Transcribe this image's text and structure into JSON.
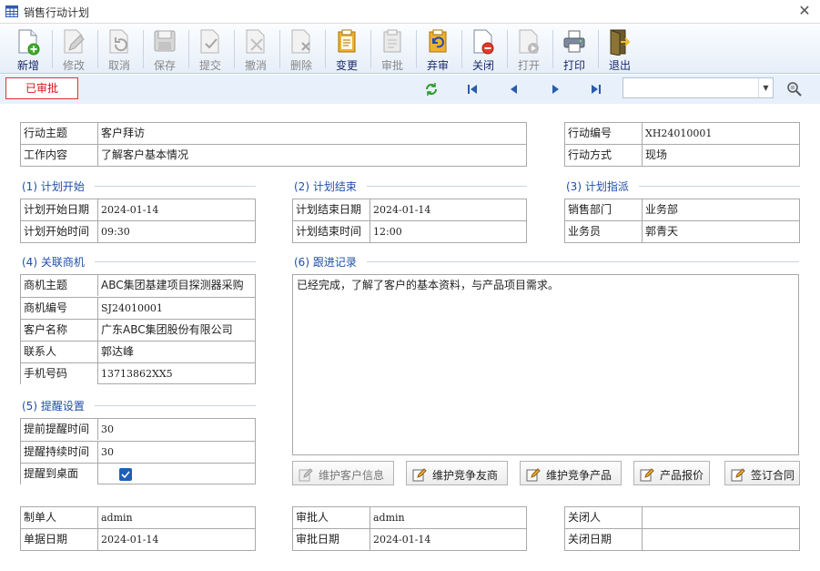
{
  "window": {
    "title": "销售行动计划"
  },
  "toolbar": [
    {
      "label": "新增",
      "icon": "new-doc-icon",
      "enabled": true
    },
    {
      "label": "修改",
      "icon": "edit-icon",
      "enabled": false
    },
    {
      "label": "取消",
      "icon": "undo-icon",
      "enabled": false
    },
    {
      "label": "保存",
      "icon": "save-icon",
      "enabled": false
    },
    {
      "label": "提交",
      "icon": "submit-icon",
      "enabled": false
    },
    {
      "label": "撤消",
      "icon": "revoke-icon",
      "enabled": false
    },
    {
      "label": "删除",
      "icon": "delete-icon",
      "enabled": false
    },
    {
      "label": "变更",
      "icon": "change-icon",
      "enabled": true
    },
    {
      "label": "审批",
      "icon": "approve-icon",
      "enabled": false
    },
    {
      "label": "弃审",
      "icon": "unapprove-icon",
      "enabled": true
    },
    {
      "label": "关闭",
      "icon": "close-doc-icon",
      "enabled": true
    },
    {
      "label": "打开",
      "icon": "open-doc-icon",
      "enabled": false
    },
    {
      "label": "打印",
      "icon": "printer-icon",
      "enabled": true
    },
    {
      "label": "退出",
      "icon": "exit-icon",
      "enabled": true
    }
  ],
  "status": "已审批",
  "nav": {
    "combo_value": ""
  },
  "header": {
    "theme_label": "行动主题",
    "theme_value": "客户拜访",
    "content_label": "工作内容",
    "content_value": "了解客户基本情况",
    "code_label": "行动编号",
    "code_value": "XH24010001",
    "method_label": "行动方式",
    "method_value": "现场"
  },
  "plan_start": {
    "title": "(1) 计划开始",
    "date_label": "计划开始日期",
    "date_value": "2024-01-14",
    "time_label": "计划开始时间",
    "time_value": "09:30"
  },
  "plan_end": {
    "title": "(2) 计划结束",
    "date_label": "计划结束日期",
    "date_value": "2024-01-14",
    "time_label": "计划结束时间",
    "time_value": "12:00"
  },
  "plan_assign": {
    "title": "(3) 计划指派",
    "dept_label": "销售部门",
    "dept_value": "业务部",
    "staff_label": "业务员",
    "staff_value": "郭青天"
  },
  "opportunity": {
    "title": "(4) 关联商机",
    "subject_label": "商机主题",
    "subject_value": "ABC集团基建项目探测器采购",
    "code_label": "商机编号",
    "code_value": "SJ24010001",
    "customer_label": "客户名称",
    "customer_value": "广东ABC集团股份有限公司",
    "contact_label": "联系人",
    "contact_value": "郭达峰",
    "phone_label": "手机号码",
    "phone_value": "13713862XX5"
  },
  "reminder": {
    "title": "(5) 提醒设置",
    "advance_label": "提前提醒时间",
    "advance_value": "30",
    "duration_label": "提醒持续时间",
    "duration_value": "30",
    "desktop_label": "提醒到桌面",
    "desktop_checked": true
  },
  "followup": {
    "title": "(6) 跟进记录",
    "text": "已经完成，了解了客户的基本资料，与产品项目需求。"
  },
  "actions": [
    {
      "label": "维护客户信息",
      "enabled": false
    },
    {
      "label": "维护竞争友商",
      "enabled": true
    },
    {
      "label": "维护竞争产品",
      "enabled": true
    },
    {
      "label": "产品报价",
      "enabled": true
    },
    {
      "label": "签订合同",
      "enabled": true
    }
  ],
  "footer": {
    "maker_label": "制单人",
    "maker_value": "admin",
    "bill_date_label": "单据日期",
    "bill_date_value": "2024-01-14",
    "approver_label": "审批人",
    "approver_value": "admin",
    "approve_date_label": "审批日期",
    "approve_date_value": "2024-01-14",
    "closer_label": "关闭人",
    "closer_value": "",
    "close_date_label": "关闭日期",
    "close_date_value": ""
  }
}
